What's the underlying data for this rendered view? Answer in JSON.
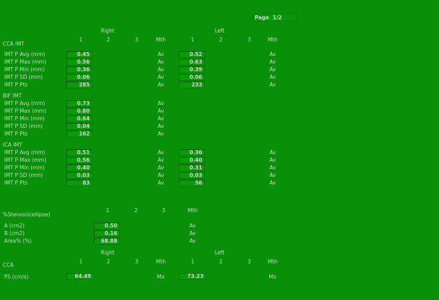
{
  "page": {
    "label": "Page",
    "value": "1/2"
  },
  "headers": {
    "right": "Right",
    "left": "Left",
    "col1": "1",
    "col2": "2",
    "col3": "3",
    "mth": "Mth"
  },
  "cca_imt": {
    "title": "CCA IMT",
    "rows": [
      {
        "label": "IMT P Avg (mm)",
        "right": "0.45",
        "right_mth": "Av",
        "left": "0.52",
        "left_mth": "Av"
      },
      {
        "label": "IMT P Max (mm)",
        "right": "0.56",
        "right_mth": "Av",
        "left": "0.63",
        "left_mth": "Av"
      },
      {
        "label": "IMT P Min (mm)",
        "right": "0.36",
        "right_mth": "Av",
        "left": "0.39",
        "left_mth": "Av"
      },
      {
        "label": "IMT P SD (mm)",
        "right": "0.06",
        "right_mth": "Av",
        "left": "0.06",
        "left_mth": "Av"
      },
      {
        "label": "IMT P Pts",
        "right": "285",
        "right_mth": "Av",
        "left": "233",
        "left_mth": "Av"
      }
    ]
  },
  "bif_imt": {
    "title": "BIF IMT",
    "rows": [
      {
        "label": "IMT P Avg (mm)",
        "right": "0.73",
        "right_mth": "Av"
      },
      {
        "label": "IMT P Max (mm)",
        "right": "0.80",
        "right_mth": "Av"
      },
      {
        "label": "IMT P Min (mm)",
        "right": "0.64",
        "right_mth": "Av"
      },
      {
        "label": "IMT P SD (mm)",
        "right": "0.04",
        "right_mth": "Av"
      },
      {
        "label": "IMT P Pts",
        "right": "162",
        "right_mth": "Av"
      }
    ]
  },
  "ica_imt": {
    "title": "ICA IMT",
    "rows": [
      {
        "label": "IMT P Avg (mm)",
        "right": "0.51",
        "right_mth": "Av",
        "left": "0.36",
        "left_mth": "Av"
      },
      {
        "label": "IMT P Max (mm)",
        "right": "0.56",
        "right_mth": "Av",
        "left": "0.40",
        "left_mth": "Av"
      },
      {
        "label": "IMT P Min (mm)",
        "right": "0.40",
        "right_mth": "Av",
        "left": "0.31",
        "left_mth": "Av"
      },
      {
        "label": "IMT P SD (mm)",
        "right": "0.03",
        "right_mth": "Av",
        "left": "0.03",
        "left_mth": "Av"
      },
      {
        "label": "IMT P Pts",
        "right": "83",
        "right_mth": "Av",
        "left": "56",
        "left_mth": "Av"
      }
    ]
  },
  "stenosis": {
    "title": "%Stenosis(ellipse)",
    "col1": "1",
    "col2": "2",
    "col3": "3",
    "mth": "Mth",
    "rows": [
      {
        "label": "A (cm2)",
        "value": "0.50",
        "mth": "Av"
      },
      {
        "label": "B (cm2)",
        "value": "0.16",
        "mth": "Av"
      },
      {
        "label": "Area% (%)",
        "value": "68.88",
        "mth": "Av"
      }
    ]
  },
  "cca": {
    "title": "CCA",
    "rows": [
      {
        "label": "PS (cm/s)",
        "right": "64.49",
        "right_mth": "Mx",
        "left": "73.23",
        "left_mth": "Mx"
      }
    ]
  }
}
